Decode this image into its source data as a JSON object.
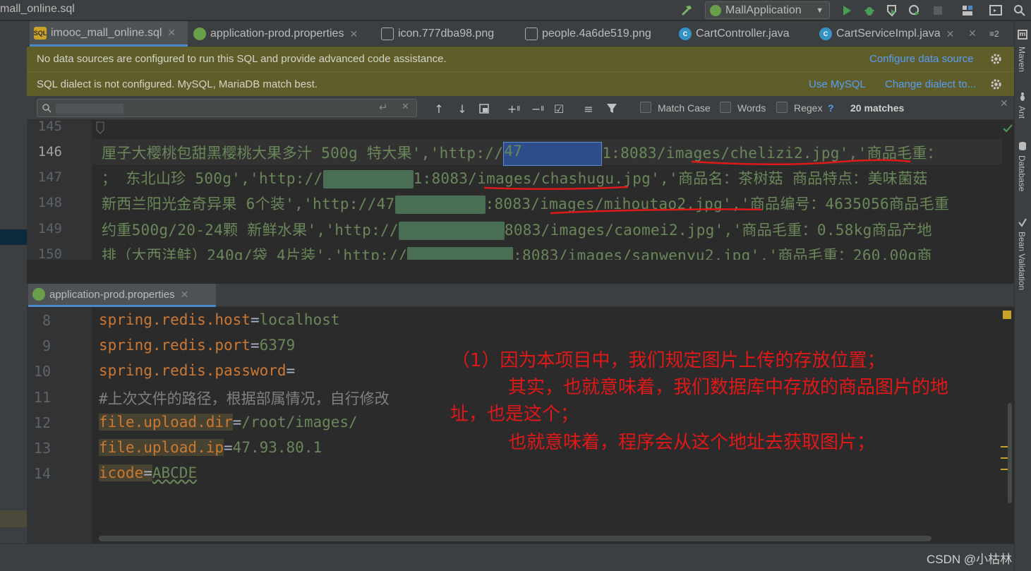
{
  "window": {
    "title": "mall_online.sql",
    "run_config": "MallApplication"
  },
  "tabs": [
    {
      "label": "imooc_mall_online.sql",
      "icon": "sql-file-icon"
    },
    {
      "label": "application-prod.properties",
      "icon": "properties-file-icon"
    },
    {
      "label": "icon.777dba98.png",
      "icon": "image-file-icon"
    },
    {
      "label": "people.4a6de519.png",
      "icon": "image-file-icon"
    },
    {
      "label": "CartController.java",
      "icon": "java-class-icon"
    },
    {
      "label": "CartServiceImpl.java",
      "icon": "java-class-icon"
    }
  ],
  "tab_overflow": "≡2",
  "banners": {
    "datasource": {
      "message": "No data sources are configured to run this SQL and provide advanced code assistance.",
      "link": "Configure data source"
    },
    "dialect": {
      "message": "SQL dialect is not configured. MySQL, MariaDB match best.",
      "link1": "Use MySQL",
      "link2": "Change dialect to..."
    }
  },
  "search": {
    "match_case": "Match Case",
    "words": "Words",
    "regex": "Regex",
    "regex_help": "?",
    "matches": "20 matches"
  },
  "sql_editor": {
    "line_numbers": [
      "145",
      "146",
      "147",
      "148",
      "149",
      "150"
    ],
    "lines": [
      {
        "a": "厘子大樱桃包甜黑樱桃大果多汁 500g 特大果','http://",
        "b": "47",
        "c": "1:8083/images/chelizi2.jpg','商品毛重："
      },
      {
        "a": "； 东北山珍 500g','http://",
        "b": "1:8083/images/chashugu.jpg','商品名：茶树菇 商品特点：美味菌菇"
      },
      {
        "a": "新西兰阳光金奇异果 6个装','http://47",
        "b": ":8083/images/mihoutao2.jpg','商品编号：4635056商品毛重"
      },
      {
        "a": "约重500g/20-24颗 新鲜水果','http://",
        "b": "8083/images/caomei2.jpg','商品毛重：0.58kg商品产地"
      },
      {
        "a": "排（大西洋鲑）240g/袋 4片装','http://",
        "b": ":8083/images/sanwenyu2.jpg','商品毛重：260.00g商"
      }
    ]
  },
  "props_tab": {
    "label": "application-prod.properties"
  },
  "props_editor": {
    "line_numbers": [
      "8",
      "9",
      "10",
      "11",
      "12",
      "13",
      "14"
    ],
    "lines": [
      {
        "key": "spring.redis.host",
        "eq": "=",
        "val": "localhost"
      },
      {
        "key": "spring.redis.port",
        "eq": "=",
        "val": "6379"
      },
      {
        "key": "spring.redis.password",
        "eq": "=",
        "val": ""
      },
      {
        "comment": "#上次文件的路径，根据部属情况，自行修改"
      },
      {
        "key": "file.upload.dir",
        "eq": "=",
        "val": "/root/images/"
      },
      {
        "key": "file.upload.ip",
        "eq": "=",
        "val": "47.93.80.1"
      },
      {
        "key": "icode",
        "eq": "=",
        "val": "ABCDE"
      }
    ]
  },
  "annotation": {
    "line1": "（1）因为本项目中，我们规定图片上传的存放位置；",
    "line2": "其实，也就意味着，我们数据库中存放的商品图片的地",
    "line3": "址，也是这个；",
    "line4": "也就意味着，程序会从这个地址去获取图片；"
  },
  "side_tools": [
    "Maven",
    "Ant",
    "Database",
    "Bean Validation"
  ],
  "watermark": "CSDN @小枯林",
  "colors": {
    "annotation": "#e01818",
    "banner": "#5f5d2a",
    "accent": "#4a88c7"
  }
}
